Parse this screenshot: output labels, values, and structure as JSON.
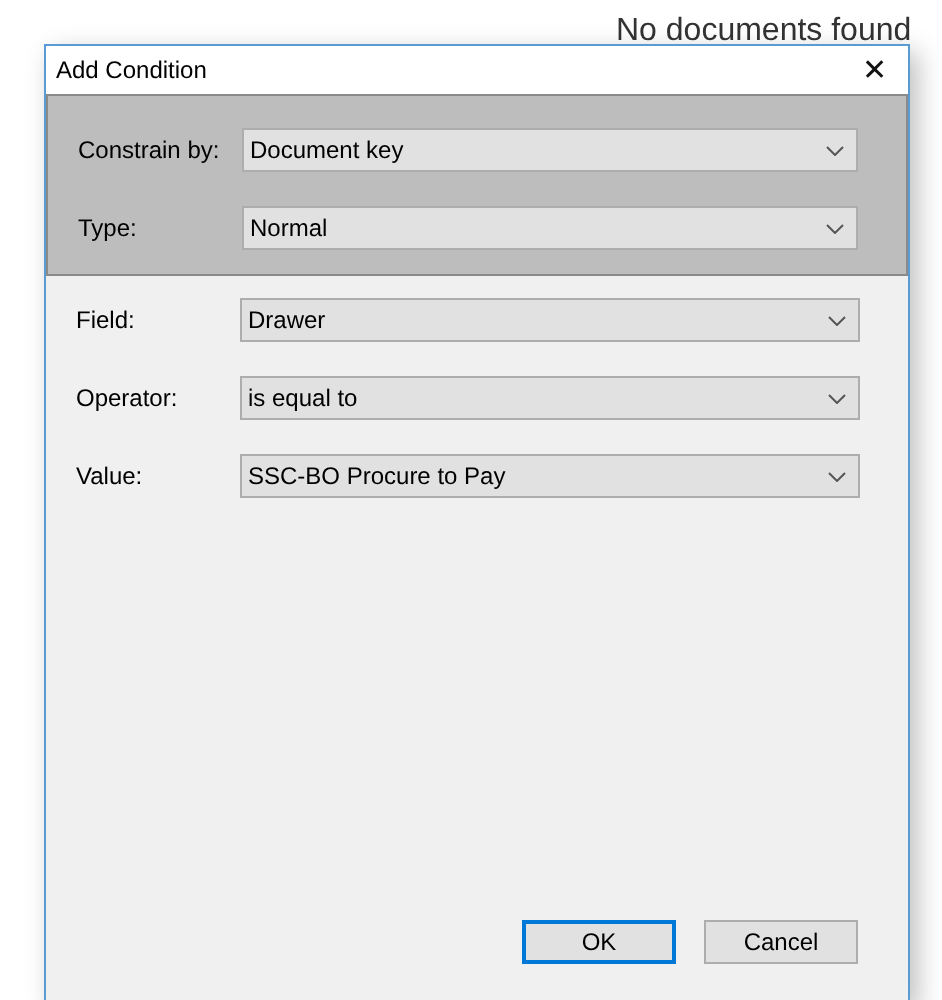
{
  "background": {
    "message": "No documents found"
  },
  "window": {
    "title": "Add Condition",
    "close": "✕"
  },
  "constraint_fields": [
    {
      "label": "Constrain by:",
      "value": "Document key"
    },
    {
      "label": "Type:",
      "value": "Normal"
    }
  ],
  "fields": [
    {
      "label": "Field:",
      "value": "Drawer"
    },
    {
      "label": "Operator:",
      "value": "is equal to"
    },
    {
      "label": "Value:",
      "value": "SSC-BO Procure to Pay"
    }
  ],
  "buttons": [
    {
      "label": "OK",
      "default": true
    },
    {
      "label": "Cancel",
      "default": false
    }
  ]
}
